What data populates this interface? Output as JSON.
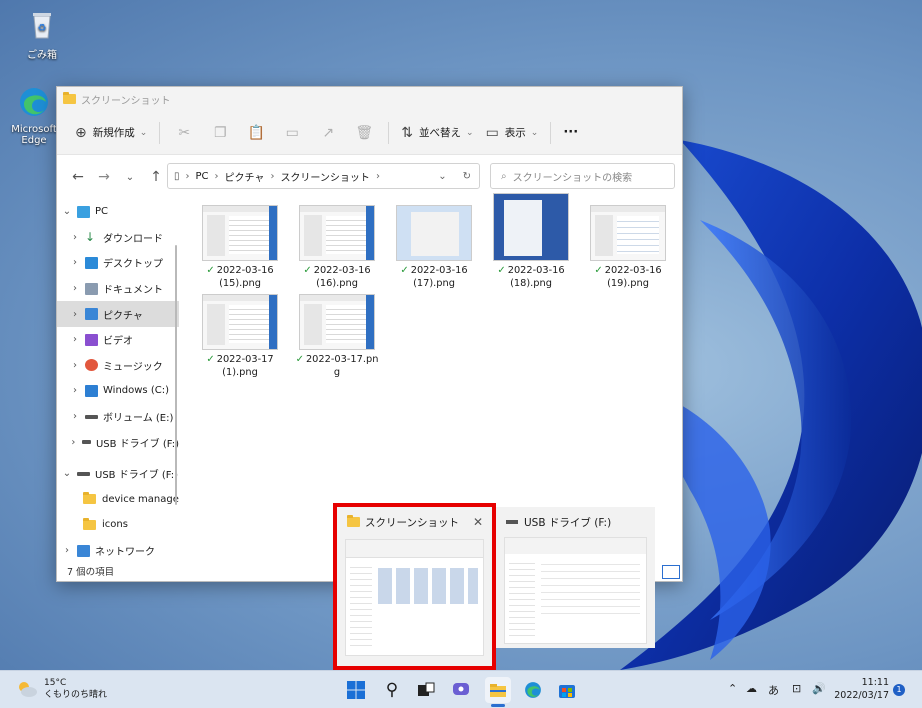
{
  "desktop": {
    "icons": [
      {
        "label": "ごみ箱"
      },
      {
        "label": "Microsoft Edge"
      }
    ]
  },
  "explorer": {
    "title": "スクリーンショット",
    "toolbar": {
      "new_label": "新規作成",
      "sort_label": "並べ替え",
      "view_label": "表示",
      "more_label": "···"
    },
    "address": {
      "crumbs": [
        "PC",
        "ピクチャ",
        "スクリーンショット"
      ]
    },
    "search": {
      "placeholder": "スクリーンショットの検索"
    },
    "sidebar": {
      "items": [
        {
          "label": "PC"
        },
        {
          "label": "ダウンロード"
        },
        {
          "label": "デスクトップ"
        },
        {
          "label": "ドキュメント"
        },
        {
          "label": "ピクチャ"
        },
        {
          "label": "ビデオ"
        },
        {
          "label": "ミュージック"
        },
        {
          "label": "Windows (C:)"
        },
        {
          "label": "ボリューム (E:)"
        },
        {
          "label": "USB ドライブ (F:)"
        },
        {
          "label": "USB ドライブ (F:)"
        },
        {
          "label": "device manage"
        },
        {
          "label": "icons"
        },
        {
          "label": "ネットワーク"
        }
      ]
    },
    "files": [
      {
        "line1": "2022-03-16",
        "line2": "(15).png"
      },
      {
        "line1": "2022-03-16",
        "line2": "(16).png"
      },
      {
        "line1": "2022-03-16",
        "line2": "(17).png"
      },
      {
        "line1": "2022-03-16",
        "line2": "(18).png"
      },
      {
        "line1": "2022-03-16",
        "line2": "(19).png"
      },
      {
        "line1": "2022-03-17",
        "line2": "(1).png"
      },
      {
        "line1": "2022-03-17.pn",
        "line2": "g"
      }
    ],
    "status": "7 個の項目"
  },
  "alt_tab": {
    "window1_title": "スクリーンショット",
    "window2_title": "USB ドライブ (F:)"
  },
  "taskbar": {
    "weather_temp": "15°C",
    "weather_text": "くもりのち晴れ",
    "ime": "あ",
    "time": "11:11",
    "date": "2022/03/17",
    "notifications": "1"
  }
}
